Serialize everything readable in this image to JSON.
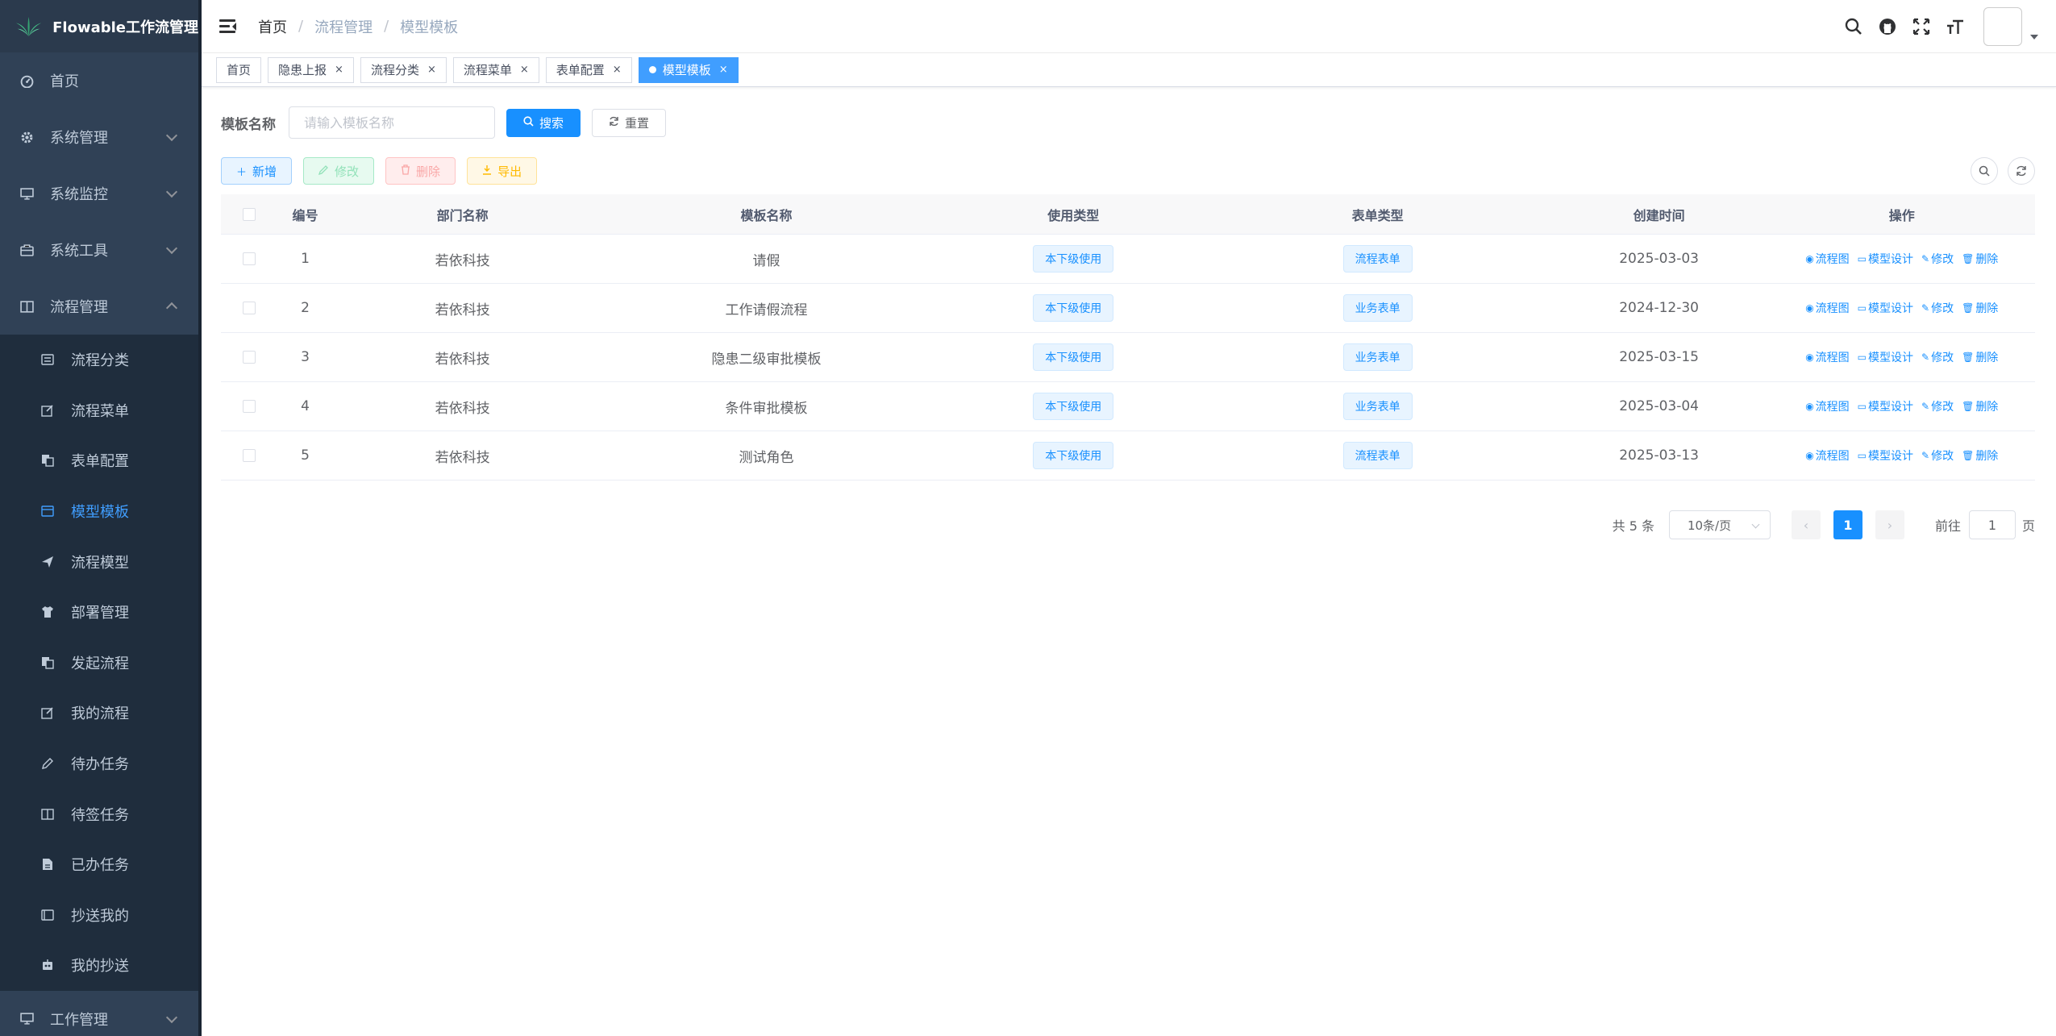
{
  "app": {
    "title": "Flowable工作流管理"
  },
  "sidebar": {
    "top_items": [
      {
        "label": "首页",
        "icon": "dashboard-icon"
      },
      {
        "label": "系统管理",
        "icon": "gear-icon"
      },
      {
        "label": "系统监控",
        "icon": "monitor-icon"
      },
      {
        "label": "系统工具",
        "icon": "toolbox-icon"
      },
      {
        "label": "流程管理",
        "icon": "book-icon",
        "expanded": true
      }
    ],
    "sub_items": [
      {
        "label": "流程分类",
        "icon": "list-icon"
      },
      {
        "label": "流程菜单",
        "icon": "edit-icon"
      },
      {
        "label": "表单配置",
        "icon": "copy-icon"
      },
      {
        "label": "模型模板",
        "icon": "calendar-icon",
        "active": true
      },
      {
        "label": "流程模型",
        "icon": "send-icon"
      },
      {
        "label": "部署管理",
        "icon": "shirt-icon"
      },
      {
        "label": "发起流程",
        "icon": "copy-icon"
      },
      {
        "label": "我的流程",
        "icon": "edit-icon"
      },
      {
        "label": "待办任务",
        "icon": "pen-icon"
      },
      {
        "label": "待签任务",
        "icon": "book-icon"
      },
      {
        "label": "已办任务",
        "icon": "document-icon"
      },
      {
        "label": "抄送我的",
        "icon": "tablet-icon"
      },
      {
        "label": "我的抄送",
        "icon": "robot-icon"
      }
    ],
    "bottom_items": [
      {
        "label": "工作管理",
        "icon": "monitor-icon"
      }
    ]
  },
  "breadcrumb": [
    "首页",
    "流程管理",
    "模型模板"
  ],
  "tags": [
    {
      "label": "首页",
      "closable": false
    },
    {
      "label": "隐患上报",
      "closable": true
    },
    {
      "label": "流程分类",
      "closable": true
    },
    {
      "label": "流程菜单",
      "closable": true
    },
    {
      "label": "表单配置",
      "closable": true
    },
    {
      "label": "模型模板",
      "closable": true,
      "active": true
    }
  ],
  "search": {
    "label": "模板名称",
    "placeholder": "请输入模板名称",
    "value": "",
    "search_label": "搜索",
    "reset_label": "重置"
  },
  "toolbar": {
    "add_label": "新增",
    "edit_label": "修改",
    "delete_label": "删除",
    "export_label": "导出"
  },
  "table": {
    "columns": [
      "编号",
      "部门名称",
      "模板名称",
      "使用类型",
      "表单类型",
      "创建时间",
      "操作"
    ],
    "rows": [
      {
        "id": "1",
        "dept": "若依科技",
        "name": "请假",
        "use_type": "本下级使用",
        "form_type": "流程表单",
        "created": "2025-03-03"
      },
      {
        "id": "2",
        "dept": "若依科技",
        "name": "工作请假流程",
        "use_type": "本下级使用",
        "form_type": "业务表单",
        "created": "2024-12-30"
      },
      {
        "id": "3",
        "dept": "若依科技",
        "name": "隐患二级审批模板",
        "use_type": "本下级使用",
        "form_type": "业务表单",
        "created": "2025-03-15"
      },
      {
        "id": "4",
        "dept": "若依科技",
        "name": "条件审批模板",
        "use_type": "本下级使用",
        "form_type": "业务表单",
        "created": "2025-03-04"
      },
      {
        "id": "5",
        "dept": "若依科技",
        "name": "测试角色",
        "use_type": "本下级使用",
        "form_type": "流程表单",
        "created": "2025-03-13"
      }
    ],
    "row_actions": [
      "流程图",
      "模型设计",
      "修改",
      "删除"
    ]
  },
  "pagination": {
    "total_text": "共 5 条",
    "page_size": "10条/页",
    "current_page": "1",
    "goto_label": "前往",
    "goto_value": "1",
    "page_suffix": "页"
  },
  "colors": {
    "sidebar_bg": "#304156",
    "primary": "#1890ff",
    "active_menu": "#409eff"
  }
}
